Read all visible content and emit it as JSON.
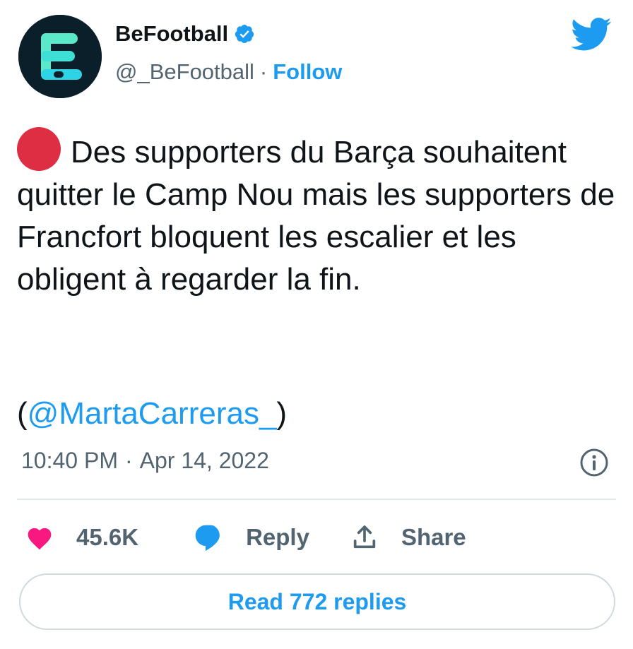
{
  "account": {
    "display_name": "BeFootball",
    "handle": "@_BeFootball",
    "separator": "·",
    "follow_label": "Follow",
    "verified": true,
    "avatar_icon": "befootball-logo-icon"
  },
  "tweet": {
    "emoji": "red-circle-emoji",
    "text": "Des supporters du Barça souhaitent quitter le Camp Nou mais les supporters de Francfort bloquent les escalier et les obligent à regarder la fin.",
    "mention_open": "(",
    "mention": "@MartaCarreras_",
    "mention_close": ")",
    "time": "10:40 PM",
    "date": "Apr 14, 2022"
  },
  "actions": {
    "like_count": "45.6K",
    "reply_label": "Reply",
    "share_label": "Share"
  },
  "read_replies_label": "Read 772 replies",
  "icons": {
    "brand": "twitter-bird-icon",
    "info": "info-icon",
    "like": "heart-icon",
    "reply": "speech-bubble-icon",
    "share": "share-arrow-icon",
    "verified": "verified-badge-icon"
  },
  "colors": {
    "accent": "#1d9bf0",
    "heart": "#f91880",
    "red_circle": "#dd2e44",
    "avatar_bg": "#0b1f2a",
    "avatar_logo": "#3ee0d6",
    "muted_text": "#536471"
  }
}
